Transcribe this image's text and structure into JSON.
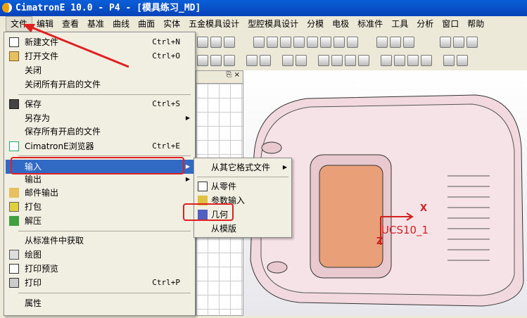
{
  "window": {
    "title": "CimatronE 10.0 - P4 - [模具练习_MD]"
  },
  "menubar": [
    "文件",
    "编辑",
    "查看",
    "基准",
    "曲线",
    "曲面",
    "实体",
    "五金模具设计",
    "型腔模具设计",
    "分模",
    "电极",
    "标准件",
    "工具",
    "分析",
    "窗口",
    "帮助"
  ],
  "file_menu": [
    {
      "label": "新建文件",
      "shortcut": "Ctrl+N",
      "icon": "new-file-icon"
    },
    {
      "label": "打开文件",
      "shortcut": "Ctrl+O",
      "icon": "open-folder-icon"
    },
    {
      "label": "关闭"
    },
    {
      "label": "关闭所有开启的文件"
    },
    {
      "label": "保存",
      "shortcut": "Ctrl+S",
      "icon": "save-icon"
    },
    {
      "label": "另存为",
      "submenu": true
    },
    {
      "label": "保存所有开启的文件"
    },
    {
      "label": "CimatronE浏览器",
      "shortcut": "Ctrl+E",
      "icon": "browser-icon"
    },
    {
      "label": "输入",
      "submenu": true,
      "highlighted": true
    },
    {
      "label": "输出",
      "submenu": true
    },
    {
      "label": "邮件输出",
      "icon": "mail-icon"
    },
    {
      "label": "打包",
      "icon": "pack-icon"
    },
    {
      "label": "解压",
      "icon": "unpack-icon"
    },
    {
      "label": "从标准件中获取"
    },
    {
      "label": "绘图",
      "icon": "drawing-icon"
    },
    {
      "label": "打印预览",
      "icon": "print-preview-icon"
    },
    {
      "label": "打印",
      "shortcut": "Ctrl+P",
      "icon": "print-icon"
    },
    {
      "label": "属性"
    }
  ],
  "import_submenu": [
    {
      "label": "从其它格式文件",
      "submenu": true
    },
    {
      "label": "从零件"
    },
    {
      "label": "参数输入"
    },
    {
      "label": "几何",
      "highlighted_box": true
    },
    {
      "label": "从模版"
    }
  ],
  "viewport": {
    "ucs_label": "UCS10_1",
    "axis_x": "X",
    "axis_z": "Z"
  },
  "colors": {
    "accent": "#316ac5",
    "annotation": "#e02020"
  }
}
